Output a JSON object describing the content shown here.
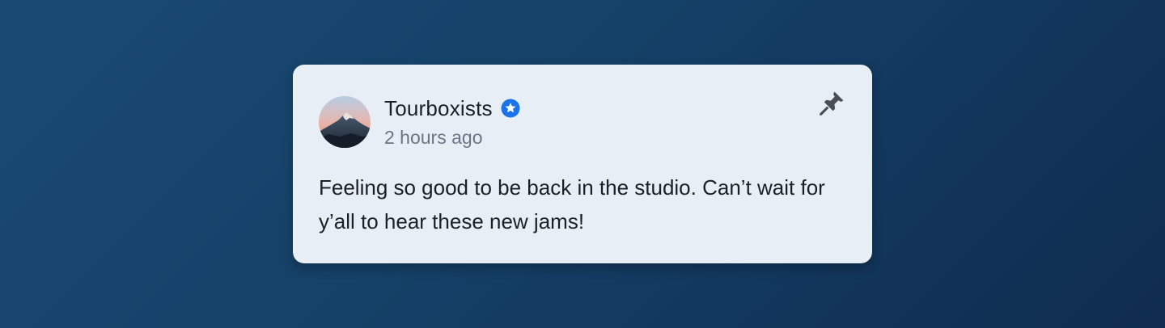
{
  "post": {
    "author": "Tourboxists",
    "verified": true,
    "timestamp": "2 hours ago",
    "text": "Feeling so good to be back in the studio. Can’t wait for y’all to hear these new jams!",
    "avatar_icon": "mountain-avatar",
    "verified_icon": "verified-star-badge-icon",
    "pin_icon": "pushpin-icon"
  },
  "colors": {
    "background_start": "#1a4a73",
    "background_end": "#0f2c4f",
    "card": "#e8eef6",
    "verified_badge": "#1a73e8",
    "text_primary": "#1b1f27",
    "text_secondary": "#6b7583",
    "pin": "#4a4f57"
  }
}
